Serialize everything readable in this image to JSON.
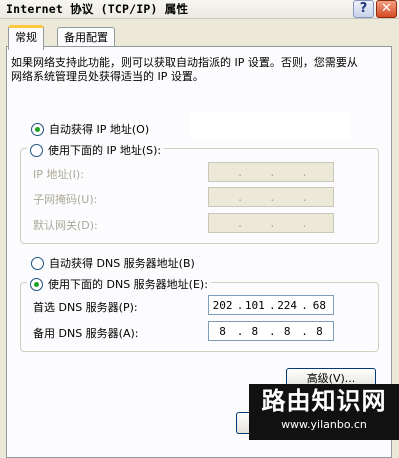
{
  "window": {
    "title": "Internet 协议 (TCP/IP) 属性",
    "help_label": "?",
    "close_label": "✕"
  },
  "tabs": [
    {
      "label": "常规",
      "active": true
    },
    {
      "label": "备用配置",
      "active": false
    }
  ],
  "description": "如果网络支持此功能，则可以获取自动指派的 IP 设置。否则，您需要从网络系统管理员处获得适当的 IP 设置。",
  "ip_mode": {
    "auto_label": "自动获得 IP 地址(O)",
    "manual_label": "使用下面的 IP 地址(S):",
    "selected": "auto"
  },
  "ip_fields": [
    {
      "label": "IP 地址(I):",
      "value": [
        " ",
        " ",
        " ",
        " "
      ]
    },
    {
      "label": "子网掩码(U):",
      "value": [
        " ",
        " ",
        " ",
        " "
      ]
    },
    {
      "label": "默认网关(D):",
      "value": [
        " ",
        " ",
        " ",
        " "
      ]
    }
  ],
  "dns_mode": {
    "auto_label": "自动获得 DNS 服务器地址(B)",
    "manual_label": "使用下面的 DNS 服务器地址(E):",
    "selected": "manual"
  },
  "dns_fields": [
    {
      "label": "首选 DNS 服务器(P):",
      "octets": [
        "202",
        "101",
        "224",
        "68"
      ]
    },
    {
      "label": "备用 DNS 服务器(A):",
      "octets": [
        "8",
        "8",
        "8",
        "8"
      ]
    }
  ],
  "advanced_button": "高级(V)...",
  "watermark": {
    "main": "路由知识网",
    "sub": "www.yilanbo.cn"
  },
  "colors": {
    "window_bg": "#ece9d8",
    "panel_bg": "#fcfcfe",
    "radio_dot": "#21a121",
    "tab_highlight": "#ffc83c"
  }
}
